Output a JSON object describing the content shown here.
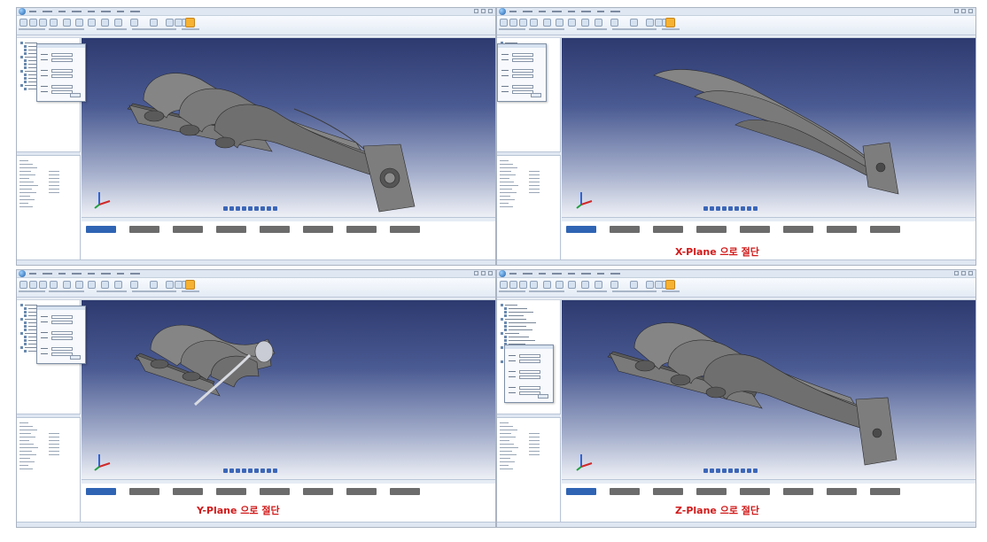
{
  "panels": [
    {
      "id": "original",
      "caption": ""
    },
    {
      "id": "x-cut",
      "caption": "X-Plane 으로 절단"
    },
    {
      "id": "y-cut",
      "caption": "Y-Plane 으로 절단"
    },
    {
      "id": "z-cut",
      "caption": "Z-Plane 으로 절단"
    }
  ],
  "colors": {
    "caption": "#d21a1a",
    "active_step": "#2f64b4",
    "step": "#6c6c6c",
    "viewport_top": "#2d3a70",
    "highlight_tool": "#f5b233"
  },
  "icons": [
    "app-logo-icon",
    "ribbon-tool-icon",
    "axis-triad-icon",
    "view-tool-icon"
  ]
}
